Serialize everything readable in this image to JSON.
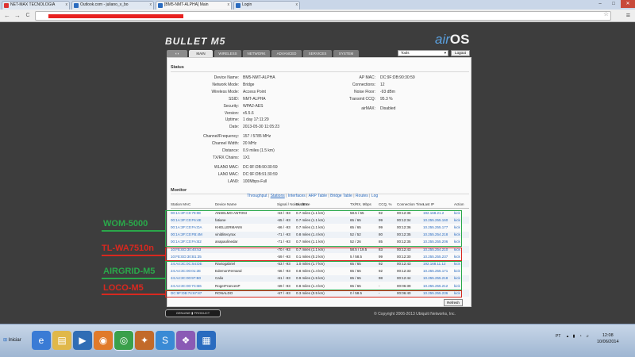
{
  "browser": {
    "tabs": [
      {
        "label": "NET-MAX TECNOLOGIA",
        "color": "#d33"
      },
      {
        "label": "Outlook.com - juliano_v_bo",
        "color": "#2a6bbf"
      },
      {
        "label": "[BM5-NMT-ALPHA] Main",
        "color": "#2a6bbf",
        "active": true
      },
      {
        "label": "Login",
        "color": "#2a6bbf"
      }
    ],
    "win_min": "–",
    "win_max": "□",
    "win_close": "✕",
    "back": "←",
    "forward": "→",
    "reload": "C"
  },
  "header": {
    "brand": "BULLET",
    "brand_model": "M5",
    "os_prefix": "air",
    "os_suffix": "OS",
    "nav": [
      "MAIN",
      "WIRELESS",
      "NETWORK",
      "ADVANCED",
      "SERVICES",
      "SYSTEM"
    ],
    "tools_label": "Tools",
    "logout_label": "Logout"
  },
  "status": {
    "heading": "Status",
    "left": [
      {
        "k": "Device Name:",
        "v": "BM5-NMT-ALPHA"
      },
      {
        "k": "Network Mode:",
        "v": "Bridge"
      },
      {
        "k": "Wireless Mode:",
        "v": "Access Point"
      },
      {
        "k": "SSID:",
        "v": "NMT-ALPHA"
      },
      {
        "k": "Security:",
        "v": "WPA2-AES"
      },
      {
        "k": "Version:",
        "v": "v5.5.6"
      },
      {
        "k": "Uptime:",
        "v": "1 day 17:11:29"
      },
      {
        "k": "Date:",
        "v": "2013-05-30 11:05:23"
      },
      {
        "k": "Channel/Frequency:",
        "v": "157 / 5785 MHz"
      },
      {
        "k": "Channel Width:",
        "v": "20 MHz"
      },
      {
        "k": "Distance:",
        "v": "0.9 miles (1.5 km)"
      },
      {
        "k": "TX/RX Chains:",
        "v": "1X1"
      },
      {
        "k": "WLAN0 MAC:",
        "v": "DC:9F:DB:90:30:59"
      },
      {
        "k": "LAN0 MAC:",
        "v": "DC:9F:DB:91:30:59"
      },
      {
        "k": "LAN0:",
        "v": "100Mbps-Full"
      }
    ],
    "right": [
      {
        "k": "AP MAC:",
        "v": "DC:9F:DB:90:30:59"
      },
      {
        "k": "Connections:",
        "v": "12"
      },
      {
        "k": "Noise Floor:",
        "v": "-93 dBm"
      },
      {
        "k": "Transmit CCQ:",
        "v": "95.3 %"
      },
      {
        "k": "airMAX:",
        "v": "Disabled"
      }
    ]
  },
  "monitor": {
    "heading": "Monitor",
    "links": [
      "Throughput",
      "Stations",
      "Interfaces",
      "ARP Table",
      "Bridge Table",
      "Routes",
      "Log"
    ],
    "columns": [
      "Station MAC",
      "Device Name",
      "Signal / Noise, dBm",
      "Distance",
      "TX/RX, Mbps",
      "CCQ, %",
      "Connection Time",
      "Last IP",
      "Action"
    ],
    "rows": [
      [
        "00:1A:3F:C0:79:0E",
        "ANSELMO ANTONI",
        "-63 / -93",
        "0.7 miles (1.1 km)",
        "58.5 / 65",
        "92",
        "00:12:36",
        "192.168.21.2",
        "kick"
      ],
      [
        "00:1A:3F:C0:F6:4E",
        "fatiane",
        "-65 / -93",
        "0.7 miles (1.1 km)",
        "65 / 65",
        "99",
        "00:12:34",
        "10.255.255.160",
        "kick"
      ],
      [
        "00:1A:3F:C0:FA:DA",
        "KHELLERMANN",
        "-66 / -93",
        "0.7 miles (1.1 km)",
        "65 / 65",
        "99",
        "00:12:36",
        "10.255.255.177",
        "kick"
      ],
      [
        "00:1A:3F:C0:FB:4M",
        "viniblitecyrax",
        "-71 / -93",
        "0.8 miles (1.4 km)",
        "52 / 52",
        "80",
        "00:12:35",
        "10.255.254.218",
        "kick"
      ],
      [
        "00:1A:3F:C0:FA:B2",
        "anapaolinedar",
        "-71 / -93",
        "0.7 miles (1.1 km)",
        "52 / 26",
        "85",
        "00:12:35",
        "10.255.255.206",
        "kick"
      ],
      [
        "10:FE:ED:30:40:53",
        "",
        "-70 / -93",
        "0.7 miles (1.1 km)",
        "58.5 / 19.5",
        "83",
        "00:12:43",
        "10.255.254.210",
        "kick"
      ],
      [
        "10:FE:ED:30:B1:35",
        "",
        "-59 / -93",
        "0.1 miles (0.2 km)",
        "5 / 58.5",
        "99",
        "00:12:30",
        "10.255.255.237",
        "kick"
      ],
      [
        "24:A4:3C:0C:54:DE",
        "Raviogabriel",
        "-53 / -93",
        "1.0 miles (1.7 km)",
        "65 / 65",
        "92",
        "00:12:43",
        "192.168.11.12",
        "kick"
      ],
      [
        "24:A4:3C:00:01:2E",
        "EdemonFernand",
        "-56 / -93",
        "0.8 miles (1.4 km)",
        "65 / 65",
        "92",
        "00:12:33",
        "10.255.255.171",
        "kick"
      ],
      [
        "24:A4:3C:00:97:B0",
        "Calio",
        "-61 / -93",
        "0.9 miles (1.5 km)",
        "65 / 65",
        "98",
        "00:12:44",
        "10.255.255.218",
        "kick"
      ],
      [
        "24:A4:3C:00:7C:B6",
        "RogerFrancesP",
        "-69 / -93",
        "0.8 miles (1.4 km)",
        "65 / 65",
        "-",
        "00:06:39",
        "10.255.255.212",
        "kick"
      ],
      [
        "DC:9F:DB:74:67:87",
        "RONALDO",
        "-67 / -93",
        "0.3 miles (0.5 km)",
        "0 / 58.5",
        "-",
        "00:06:40",
        "10.255.255.236",
        "kick"
      ]
    ],
    "refresh_label": "Refresh"
  },
  "groups": [
    {
      "label": "WOM-5000",
      "color": "#2aa84a"
    },
    {
      "label": "TL-WA7510n",
      "color": "#d8281f"
    },
    {
      "label": "AIRGRID-M5",
      "color": "#2aa84a"
    },
    {
      "label": "LOCO-M5",
      "color": "#d8281f"
    }
  ],
  "footer": {
    "genuine": "GENUINE ▮ PRODUCT",
    "copyright": "© Copyright 2006-2013 Ubiquiti Networks, Inc."
  },
  "taskbar": {
    "start": "Iniciar",
    "lang": "PT",
    "time": "12:08",
    "date": "10/06/2014"
  }
}
